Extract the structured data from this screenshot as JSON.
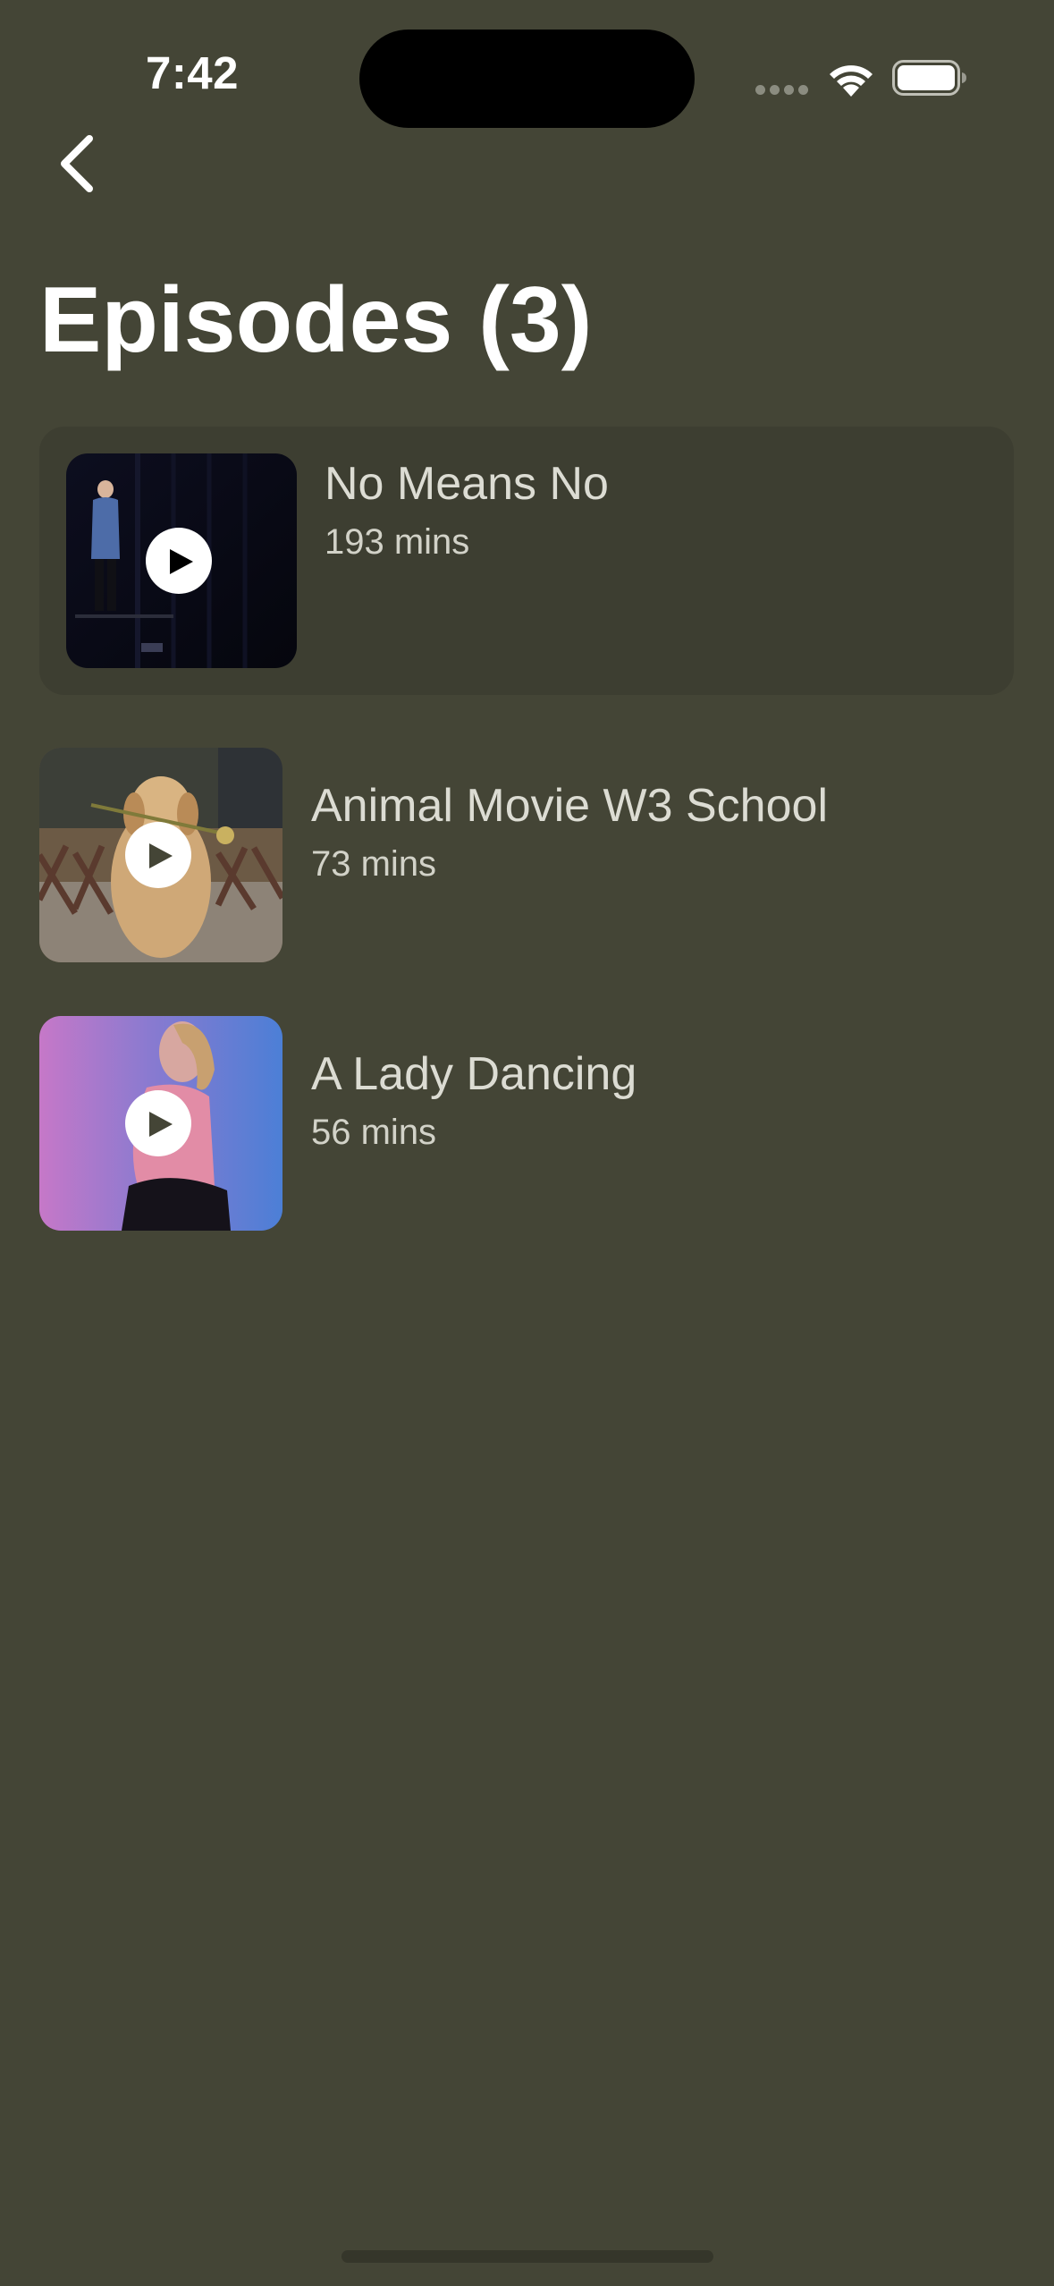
{
  "status_bar": {
    "time": "7:42",
    "signal_icon": "cellular-signal-icon",
    "wifi_icon": "wifi-icon",
    "battery_icon": "battery-icon"
  },
  "nav": {
    "back_icon": "chevron-left-icon"
  },
  "header": {
    "title": "Episodes (3)"
  },
  "episodes": [
    {
      "title": "No Means No",
      "duration": "193 mins",
      "selected": true,
      "play_icon": "play-icon"
    },
    {
      "title": "Animal Movie W3 School",
      "duration": "73 mins",
      "selected": false,
      "play_icon": "play-icon"
    },
    {
      "title": "A Lady Dancing",
      "duration": "56 mins",
      "selected": false,
      "play_icon": "play-icon"
    }
  ],
  "colors": {
    "background": "#444536",
    "selected_row": "#3d3e31",
    "title_text": "#ffffff",
    "secondary_text": "#dcdcd3"
  }
}
